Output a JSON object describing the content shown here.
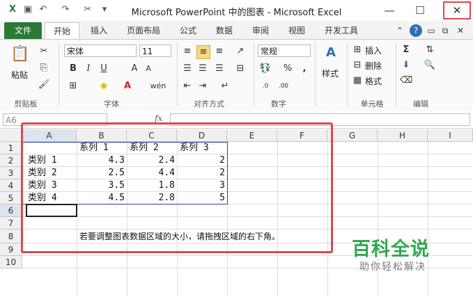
{
  "window": {
    "title": "Microsoft PowerPoint 中的图表 - Microsoft Excel"
  },
  "tabs": [
    "文件",
    "开始",
    "插入",
    "页面布局",
    "公式",
    "数据",
    "审阅",
    "视图",
    "开发工具"
  ],
  "ribbon": {
    "clipboard": {
      "paste": "粘贴",
      "label": "剪贴板"
    },
    "font": {
      "name": "宋体",
      "size": "11",
      "label": "字体",
      "bold": "B",
      "italic": "I",
      "underline": "U",
      "grow": "A",
      "phonetic": "wén"
    },
    "alignment": {
      "label": "对齐方式"
    },
    "number": {
      "format": "常规",
      "label": "数字",
      "percent": "%",
      "comma": ","
    },
    "styles": {
      "label": "样式"
    },
    "cells": {
      "insert": "插入",
      "delete": "删除",
      "format": "格式",
      "label": "单元格"
    },
    "editing": {
      "label": "编辑",
      "sum": "Σ"
    }
  },
  "formula_bar": {
    "name_box": "A6",
    "fx": "fx",
    "value": ""
  },
  "sheet": {
    "columns": [
      "A",
      "B",
      "C",
      "D",
      "E",
      "F",
      "G",
      "H",
      "I"
    ],
    "rows": [
      "1",
      "2",
      "3",
      "4",
      "5",
      "6",
      "7",
      "8",
      "9",
      "10"
    ],
    "headers": [
      "系列 1",
      "系列 2",
      "系列 3"
    ],
    "data": [
      {
        "cat": "类别 1",
        "s1": "4.3",
        "s2": "2.4",
        "s3": "2"
      },
      {
        "cat": "类别 2",
        "s1": "2.5",
        "s2": "4.4",
        "s3": "2"
      },
      {
        "cat": "类别 3",
        "s1": "3.5",
        "s2": "1.8",
        "s3": "3"
      },
      {
        "cat": "类别 4",
        "s1": "4.5",
        "s2": "2.8",
        "s3": "5"
      }
    ],
    "note": "若要调整图表数据区域的大小，请拖拽区域的右下角。",
    "selected_cell": "A6"
  },
  "watermark": {
    "brand": "百科全说",
    "slogan": "助你轻松解决"
  },
  "colors": {
    "file_tab": "#2a7a36",
    "highlight": "#e0474c",
    "watermark": "#2fa84f"
  }
}
